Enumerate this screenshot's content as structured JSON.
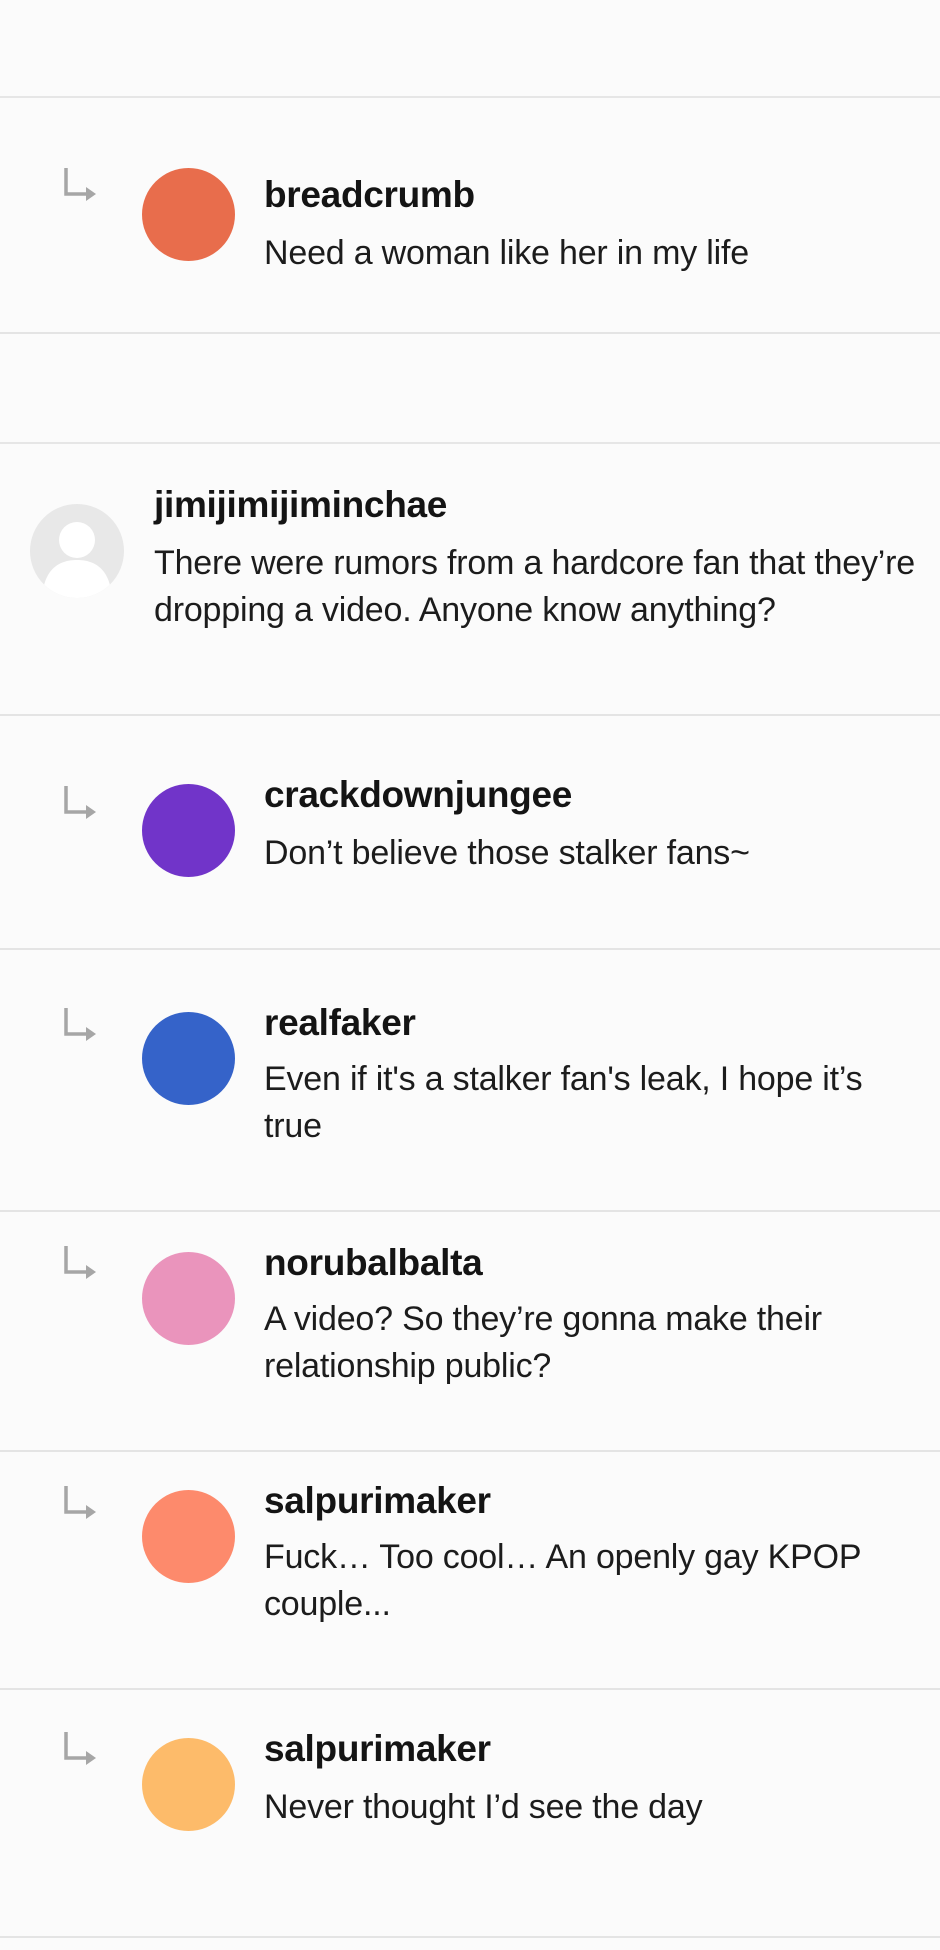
{
  "comments": [
    {
      "type": "reply",
      "username": "breadcrumb",
      "text": "Need a woman like her in my life",
      "avatar_color": "#e86d4c"
    },
    {
      "type": "top",
      "username": "jimijimijiminchae",
      "text": "There were rumors from a hardcore fan that they’re dropping a video. Anyone know anything?",
      "avatar_color": "#e8e8e8"
    },
    {
      "type": "reply",
      "username": "crackdownjungee",
      "text": "Don’t believe those stalker fans~",
      "avatar_color": "#7134c9"
    },
    {
      "type": "reply",
      "username": "realfaker",
      "text": "Even if it's a stalker fan's leak, I hope it’s true",
      "avatar_color": "#3563c9"
    },
    {
      "type": "reply",
      "username": "norubalbalta",
      "text": "A video? So they’re gonna make their relationship public?",
      "avatar_color": "#ea94bc"
    },
    {
      "type": "reply",
      "username": "salpurimaker",
      "text": "Fuck… Too cool… An openly gay KPOP couple...",
      "avatar_color": "#fd8a6c"
    },
    {
      "type": "reply",
      "username": "salpurimaker",
      "text": "Never thought I’d see the day",
      "avatar_color": "#fdbb6a"
    }
  ],
  "icons": {
    "reply_arrow": "reply-arrow-icon",
    "default_avatar": "person-icon"
  }
}
